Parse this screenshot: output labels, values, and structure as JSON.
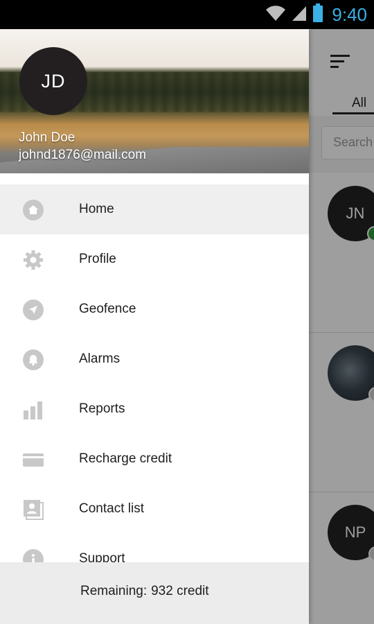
{
  "status_bar": {
    "time": "9:40",
    "icons": [
      "wifi-icon",
      "signal-icon",
      "battery-icon"
    ]
  },
  "background": {
    "tab_all": "All",
    "search_placeholder": "Search",
    "contacts": [
      {
        "initials": "JN",
        "status_color": "#2e9b3b"
      },
      {
        "initials": "",
        "status_color": "#cfcfcf"
      },
      {
        "initials": "NP",
        "status_color": "#cfcfcf"
      }
    ]
  },
  "drawer": {
    "header": {
      "avatar_initials": "JD",
      "name": "John Doe",
      "email": "johnd1876@mail.com"
    },
    "menu": [
      {
        "label": "Home",
        "icon": "home-icon",
        "selected": true
      },
      {
        "label": "Profile",
        "icon": "gear-icon"
      },
      {
        "label": "Geofence",
        "icon": "navigation-icon"
      },
      {
        "label": "Alarms",
        "icon": "bell-icon"
      },
      {
        "label": "Reports",
        "icon": "bar-chart-icon"
      },
      {
        "label": "Recharge credit",
        "icon": "credit-card-icon"
      },
      {
        "label": "Contact list",
        "icon": "contacts-icon"
      },
      {
        "label": "Support",
        "icon": "info-icon"
      }
    ],
    "footer": {
      "label": "Remaining:",
      "value": "932 credit"
    }
  },
  "colors": {
    "accent": "#3bb0e6",
    "icon_gray": "#c8c8c8",
    "selected_bg": "#efefef"
  }
}
